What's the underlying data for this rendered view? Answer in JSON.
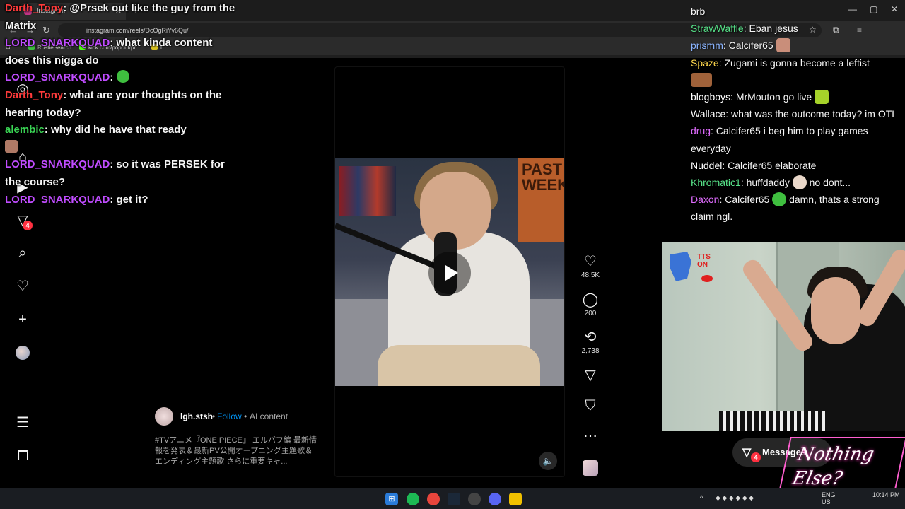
{
  "browser": {
    "tab_title": "Instagram",
    "url": "instagram.com/reels/DcOgRiYv6Qu/",
    "bookmarks": [
      "RustleSearch",
      "kick.com/popout/pr...",
      "t"
    ]
  },
  "instagram": {
    "notif_badge": "4",
    "post": {
      "username": "lgh.stsh",
      "sep1": "•",
      "follow": "Follow",
      "sep2": "•",
      "ai_label": "AI content",
      "caption": "#TVアニメ『ONE PIECE』 エルバフ編 最新情報を発表＆最新PV公開オープニング主題歌＆エンディング主題歌 さらに重要キャ..."
    },
    "actions": {
      "likes": "48.5K",
      "comments": "200",
      "reposts": "2,738"
    },
    "video_poster_text": "PAST WEEK",
    "messages": {
      "label": "Messages",
      "badge": "4"
    }
  },
  "chat_left": [
    {
      "user": "Darth_Tony",
      "color": "#ff3b3b",
      "text": ": @Prsek out like the guy from the Matrix"
    },
    {
      "user": "LORD_SNARKQUAD",
      "color": "#c04cff",
      "text": ": what kinda content does this nigga do"
    },
    {
      "user": "LORD_SNARKQUAD",
      "color": "#c04cff",
      "text": ": "
    },
    {
      "user": "Darth_Tony",
      "color": "#ff3b3b",
      "text": ": what are your thoughts on the hearing today?"
    },
    {
      "user": "alembic",
      "color": "#39d353",
      "text": ": why did he have that ready"
    },
    {
      "user": "LORD_SNARKQUAD",
      "color": "#c04cff",
      "text": ": so it was PERSEK for the course?"
    },
    {
      "user": "LORD_SNARKQUAD",
      "color": "#c04cff",
      "text": ": get it?"
    }
  ],
  "chat_right": {
    "top_text": "brb",
    "messages": [
      {
        "user": "StrawWaffle",
        "color": "#57e389",
        "text": ": Eban jesus"
      },
      {
        "user": "prismm",
        "color": "#8ab4ff",
        "text": ": Calcifer65"
      },
      {
        "user": "Spaze",
        "color": "#ffd84d",
        "text": ": Zugami is gonna become a leftist"
      },
      {
        "user": "blogboys",
        "color": "#ffffff",
        "text": ": MrMouton go live"
      },
      {
        "user": "Wallace",
        "color": "#ffffff",
        "text": ": what was the outcome today? im OTL"
      },
      {
        "user": "drug",
        "color": "#e06cff",
        "text": ": Calcifer65 i beg him to play games everyday"
      },
      {
        "user": "Nuddel",
        "color": "#ffffff",
        "text": ": Calcifer65 elaborate"
      },
      {
        "user": "Khromatic1",
        "color": "#57e389",
        "text": ": huffdaddy"
      },
      {
        "user": "Daxon",
        "color": "#e06cff",
        "text": ": Calcifer65"
      }
    ],
    "khromatic_tail": "no dont...",
    "daxon_tail": "damn, thats a strong claim ngl."
  },
  "overlay": {
    "tts_label": "TTS ON",
    "brand": "Nothing Else?"
  },
  "taskbar": {
    "lang": "ENG",
    "region": "US",
    "time": "10:14 PM"
  }
}
